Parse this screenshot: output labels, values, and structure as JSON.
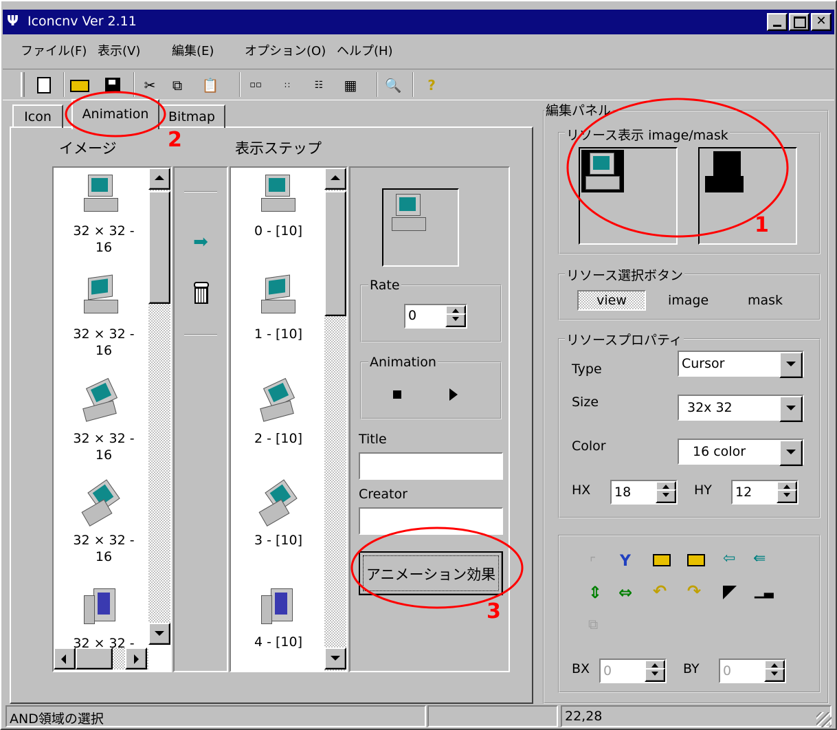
{
  "window": {
    "title": "Iconcnv Ver 2.11",
    "title_bar_color": "#0a0a80"
  },
  "menu": [
    "ファイル(F)",
    "表示(V)",
    "編集(E)",
    "オプション(O)",
    "ヘルプ(H)"
  ],
  "toolbar": [
    "new-icon",
    "open-icon",
    "save-icon",
    "cut-icon",
    "copy-icon",
    "paste-icon",
    "large-icons-view-icon",
    "small-icons-view-icon",
    "list-view-icon",
    "details-view-icon",
    "print-preview-icon",
    "help-icon"
  ],
  "tabs": {
    "icon": "Icon",
    "animation": "Animation",
    "bitmap": "Bitmap"
  },
  "left": {
    "image_header": "イメージ",
    "steps_header": "表示ステップ",
    "images": [
      {
        "label": "32 × 32 -\n16"
      },
      {
        "label": "32 × 32 -\n16"
      },
      {
        "label": "32 × 32 -\n16"
      },
      {
        "label": "32 × 32 -\n16"
      },
      {
        "label": "32 × 32 -"
      }
    ],
    "steps": [
      "0 - [10]",
      "1 - [10]",
      "2 - [10]",
      "3 - [10]",
      "4 - [10]"
    ]
  },
  "anim": {
    "rate_label": "Rate",
    "rate_value": "0",
    "animation_label": "Animation",
    "title_label": "Title",
    "title_value": "",
    "creator_label": "Creator",
    "creator_value": "",
    "effect_button": "アニメーション効果"
  },
  "edit_panel": {
    "title": "編集パネル",
    "resource_view_label": "リソース表示 image/mask",
    "select_label": "リソース選択ボタン",
    "view_btn": "view",
    "image_btn": "image",
    "mask_btn": "mask",
    "props_label": "リソースプロパティ",
    "type_label": "Type",
    "type_value": "Cursor",
    "size_label": "Size",
    "size_value": "32x 32",
    "color_label": "Color",
    "color_value": "16 color",
    "hx_label": "HX",
    "hx_value": "18",
    "hy_label": "HY",
    "hy_value": "12",
    "bx_label": "BX",
    "bx_value": "0",
    "by_label": "BY",
    "by_value": "0"
  },
  "annotations": {
    "n1": "1",
    "n2": "2",
    "n3": "3",
    "circle_color": "#ff0000"
  },
  "status": {
    "text": "AND領域の選択",
    "coords": "22,28"
  }
}
